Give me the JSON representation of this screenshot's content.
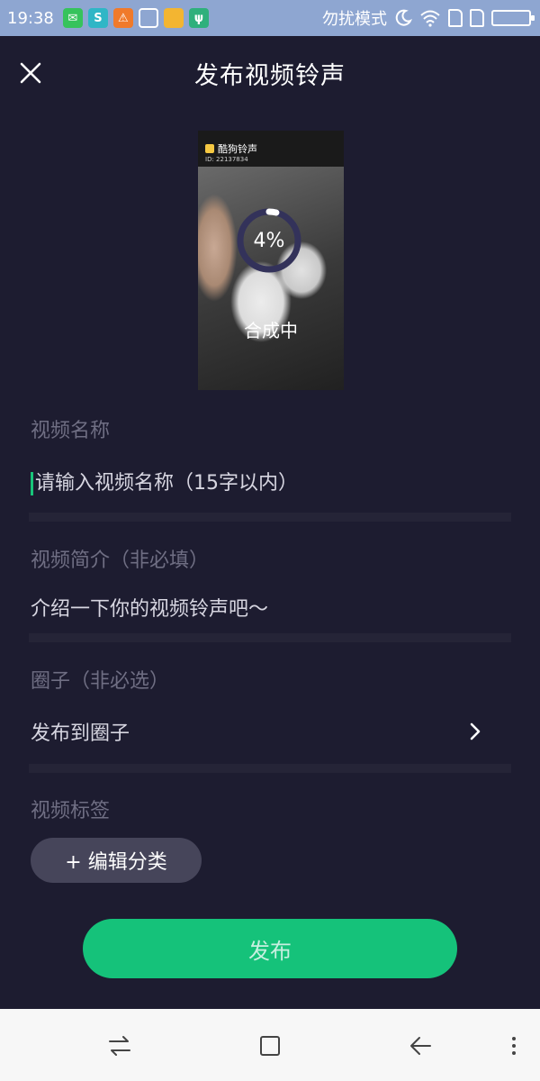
{
  "status_bar": {
    "time": "19:38",
    "dnd_label": "勿扰模式",
    "icons": [
      "wechat-icon",
      "app-s-icon",
      "warning-icon",
      "clean-icon",
      "folder-icon",
      "usb-icon",
      "moon-icon",
      "wifi-icon",
      "sim-icon",
      "sim-icon",
      "battery-icon"
    ]
  },
  "header": {
    "title": "发布视频铃声",
    "close_icon": "close-icon"
  },
  "preview": {
    "app_name": "酷狗铃声",
    "id_text": "ID: 22137834",
    "progress_text": "4%",
    "progress": 0.04,
    "status": "合成中"
  },
  "form": {
    "name_label": "视频名称",
    "name_placeholder": "请输入视频名称（15字以内）",
    "intro_label": "视频简介（非必填）",
    "intro_placeholder": "介绍一下你的视频铃声吧～",
    "circle_label": "圈子（非必选）",
    "circle_value": "发布到圈子",
    "tags_label": "视频标签",
    "edit_category": "+ 编辑分类"
  },
  "publish_label": "发布",
  "colors": {
    "background": "#1d1c30",
    "accent": "#15c27a",
    "status_bar": "#8ea6d1"
  }
}
